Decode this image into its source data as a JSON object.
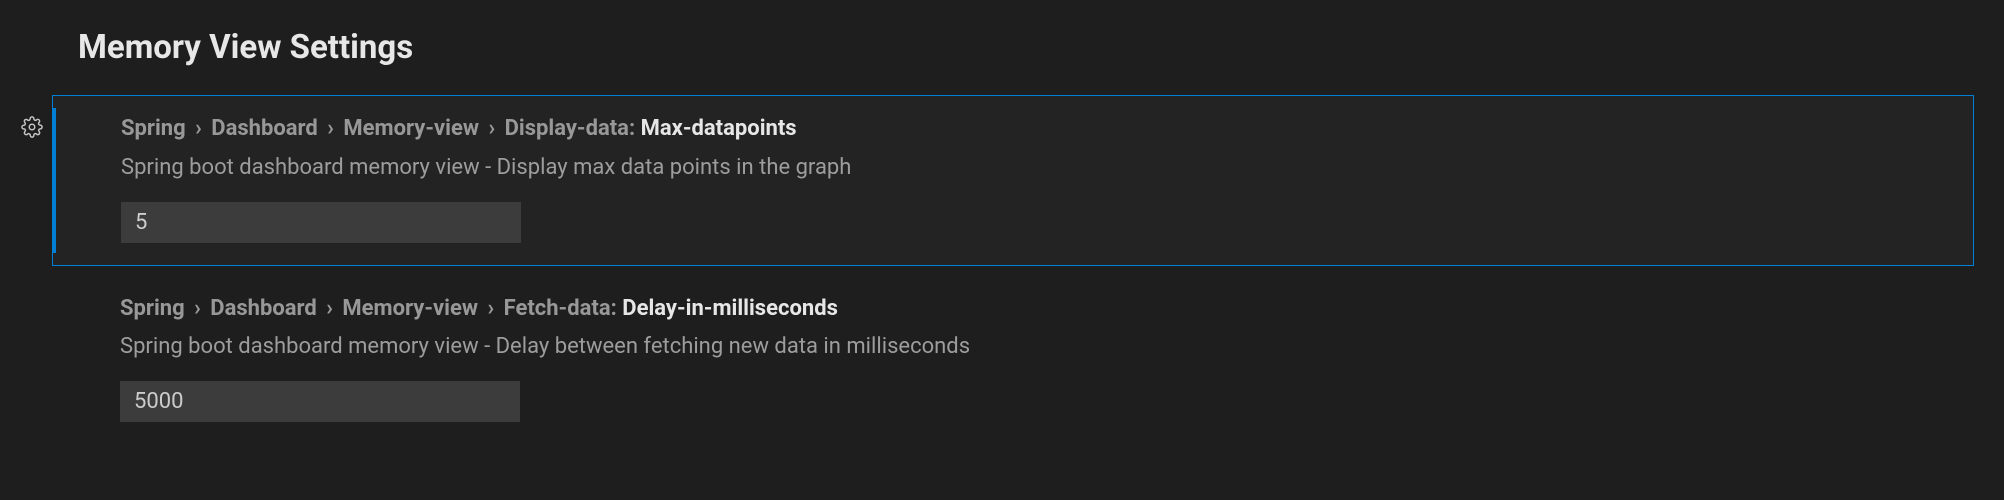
{
  "page": {
    "title": "Memory View Settings"
  },
  "settings": [
    {
      "breadcrumb": [
        "Spring",
        "Dashboard",
        "Memory-view",
        "Display-data"
      ],
      "leaf": "Max-datapoints",
      "description": "Spring boot dashboard memory view - Display max data points in the graph",
      "value": "5"
    },
    {
      "breadcrumb": [
        "Spring",
        "Dashboard",
        "Memory-view",
        "Fetch-data"
      ],
      "leaf": "Delay-in-milliseconds",
      "description": "Spring boot dashboard memory view - Delay between fetching new data in milliseconds",
      "value": "5000"
    }
  ]
}
